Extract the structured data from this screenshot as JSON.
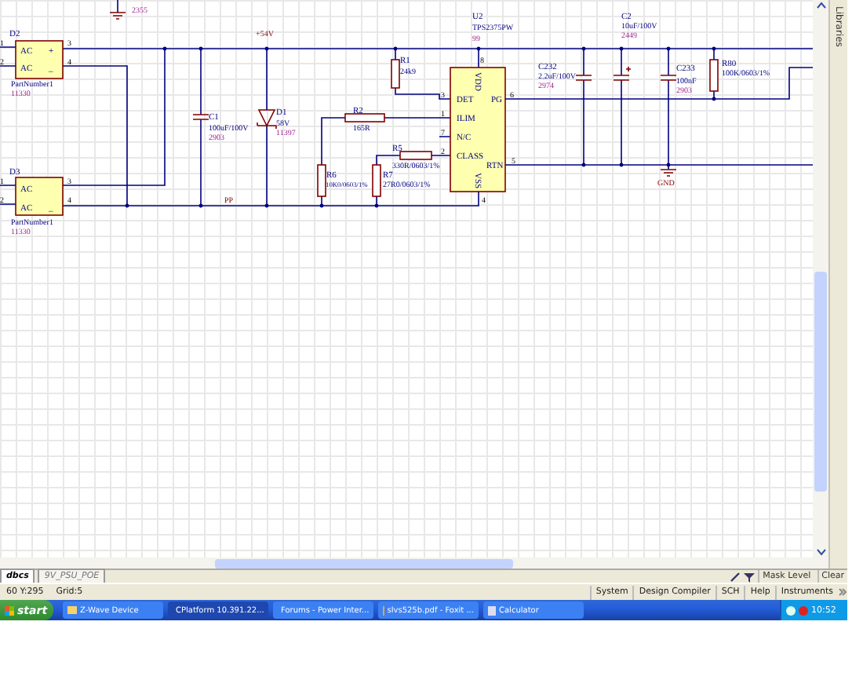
{
  "schematic": {
    "sidebar_label": "Libraries",
    "texts": [
      {
        "kind": "part_code",
        "text": "2355"
      },
      {
        "kind": "designator",
        "text": "D2"
      },
      {
        "kind": "pin_label",
        "text": "AC"
      },
      {
        "kind": "pin_label",
        "text": "+"
      },
      {
        "kind": "pin_label",
        "text": "AC"
      },
      {
        "kind": "pin_label",
        "text": "_"
      },
      {
        "kind": "pin",
        "text": "1"
      },
      {
        "kind": "pin",
        "text": "2"
      },
      {
        "kind": "pin",
        "text": "3"
      },
      {
        "kind": "pin",
        "text": "4"
      },
      {
        "kind": "value",
        "text": "PartNumber1"
      },
      {
        "kind": "part_code",
        "text": "11330"
      },
      {
        "kind": "designator",
        "text": "D3"
      },
      {
        "kind": "pin_label",
        "text": "AC"
      },
      {
        "kind": "pin_label",
        "text": "AC"
      },
      {
        "kind": "pin_label",
        "text": "_"
      },
      {
        "kind": "pin",
        "text": "1"
      },
      {
        "kind": "pin",
        "text": "2"
      },
      {
        "kind": "pin",
        "text": "3"
      },
      {
        "kind": "pin",
        "text": "4"
      },
      {
        "kind": "value",
        "text": "PartNumber1"
      },
      {
        "kind": "part_code",
        "text": "11330"
      },
      {
        "kind": "net",
        "text": "+54V"
      },
      {
        "kind": "designator",
        "text": "C1"
      },
      {
        "kind": "value",
        "text": "100uF/100V"
      },
      {
        "kind": "part_code",
        "text": "2903"
      },
      {
        "kind": "designator",
        "text": "D1"
      },
      {
        "kind": "value",
        "text": "58V"
      },
      {
        "kind": "part_code",
        "text": "11397"
      },
      {
        "kind": "net",
        "text": "PP"
      },
      {
        "kind": "designator",
        "text": "R1"
      },
      {
        "kind": "value",
        "text": "24k9"
      },
      {
        "kind": "designator",
        "text": "R2"
      },
      {
        "kind": "value",
        "text": "165R"
      },
      {
        "kind": "designator",
        "text": "R5"
      },
      {
        "kind": "value",
        "text": "330R/0603/1%"
      },
      {
        "kind": "designator",
        "text": "R6"
      },
      {
        "kind": "value",
        "text": "10K0/0603/1%"
      },
      {
        "kind": "designator",
        "text": "R7"
      },
      {
        "kind": "value",
        "text": "27R0/0603/1%"
      },
      {
        "kind": "designator",
        "text": "U2"
      },
      {
        "kind": "value",
        "text": "TPS2375PW"
      },
      {
        "kind": "part_code",
        "text": "99"
      },
      {
        "kind": "pin_label",
        "text": "DET"
      },
      {
        "kind": "pin_label",
        "text": "ILIM"
      },
      {
        "kind": "pin_label",
        "text": "N/C"
      },
      {
        "kind": "pin_label",
        "text": "CLASS"
      },
      {
        "kind": "pin_label",
        "text": "PG"
      },
      {
        "kind": "pin_label",
        "text": "RTN"
      },
      {
        "kind": "pin_label_vertical",
        "text": "VDD"
      },
      {
        "kind": "pin_label_vertical",
        "text": "VSS"
      },
      {
        "kind": "pin",
        "text": "3"
      },
      {
        "kind": "pin",
        "text": "1"
      },
      {
        "kind": "pin",
        "text": "7"
      },
      {
        "kind": "pin",
        "text": "2"
      },
      {
        "kind": "pin",
        "text": "6"
      },
      {
        "kind": "pin",
        "text": "5"
      },
      {
        "kind": "pin",
        "text": "8"
      },
      {
        "kind": "pin",
        "text": "4"
      },
      {
        "kind": "designator",
        "text": "C232"
      },
      {
        "kind": "value",
        "text": "2.2uF/100V"
      },
      {
        "kind": "part_code",
        "text": "2974"
      },
      {
        "kind": "designator",
        "text": "C2"
      },
      {
        "kind": "value",
        "text": "10uF/100V"
      },
      {
        "kind": "part_code",
        "text": "2449"
      },
      {
        "kind": "designator",
        "text": "C233"
      },
      {
        "kind": "value",
        "text": "100nF"
      },
      {
        "kind": "part_code",
        "text": "2903"
      },
      {
        "kind": "designator",
        "text": "R80"
      },
      {
        "kind": "value",
        "text": "100K/0603/1%"
      },
      {
        "kind": "net",
        "text": "GND"
      }
    ]
  },
  "document_tabs": [
    {
      "label": "dbcs",
      "selected": true
    },
    {
      "label": "9V_PSU_POE",
      "selected": false
    }
  ],
  "mask_controls": {
    "mask_level": "Mask Level",
    "clear": "Clear"
  },
  "status_bar": {
    "coordinates": "60 Y:295",
    "grid": "Grid:5",
    "panels": [
      "System",
      "Design Compiler",
      "SCH",
      "Help",
      "Instruments"
    ]
  },
  "taskbar": {
    "start": "start",
    "items": [
      {
        "label": "Z-Wave Device",
        "selected": false,
        "kind": "folder"
      },
      {
        "label": "CPlatform 10.391.22...",
        "selected": true,
        "kind": "app"
      },
      {
        "label": "Forums - Power Inter...",
        "selected": false,
        "kind": "browser"
      },
      {
        "label": "slvs525b.pdf - Foxit ...",
        "selected": false,
        "kind": "pdf"
      },
      {
        "label": "Calculator",
        "selected": false,
        "kind": "calculator"
      }
    ],
    "clock": "10:52"
  }
}
